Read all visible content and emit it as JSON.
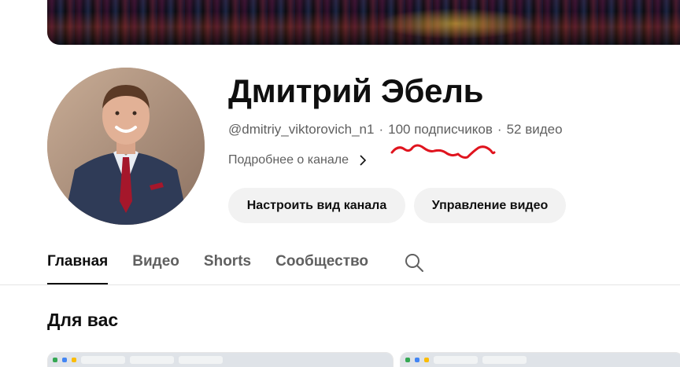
{
  "channel": {
    "name": "Дмитрий Эбель",
    "handle": "@dmitriy_viktorovich_n1",
    "separator": "·",
    "subscribers": "100 подписчиков",
    "videos": "52 видео",
    "about_label": "Подробнее о канале"
  },
  "actions": {
    "customize_label": "Настроить вид канала",
    "manage_label": "Управление видео"
  },
  "tabs": [
    {
      "label": "Главная",
      "active": true
    },
    {
      "label": "Видео",
      "active": false
    },
    {
      "label": "Shorts",
      "active": false
    },
    {
      "label": "Сообщество",
      "active": false
    }
  ],
  "section": {
    "title": "Для вас"
  },
  "icons": {
    "about": "chevron-right-icon",
    "search": "search-icon"
  },
  "colors": {
    "text_primary": "#0f0f0f",
    "text_secondary": "#606060",
    "button_bg": "#f2f2f2",
    "annotation": "#e0141e"
  }
}
